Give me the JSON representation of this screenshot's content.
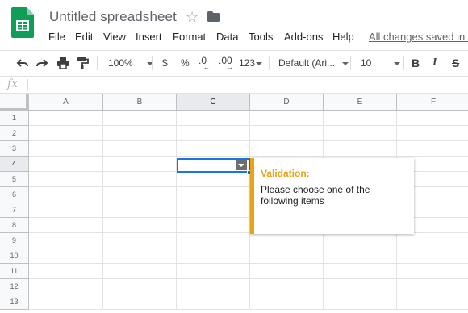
{
  "app": {
    "doc_title": "Untitled spreadsheet",
    "icons": {
      "logo": "google-sheets-logo",
      "star": "star-icon",
      "folder": "folder-icon"
    }
  },
  "menubar": {
    "items": [
      "File",
      "Edit",
      "View",
      "Insert",
      "Format",
      "Data",
      "Tools",
      "Add-ons",
      "Help"
    ],
    "save_status": "All changes saved in D"
  },
  "toolbar": {
    "zoom": "100%",
    "currency": "$",
    "percent": "%",
    "decrease_decimals": ".0",
    "increase_decimals": ".00",
    "more_formats": "123",
    "font_family": "Default (Ari...",
    "font_size": "10",
    "bold": "B",
    "italic": "I",
    "strikethrough": "S"
  },
  "formula_bar": {
    "fx_label": "fx",
    "value": ""
  },
  "grid": {
    "columns": [
      "A",
      "B",
      "C",
      "D",
      "E",
      "F"
    ],
    "rows": [
      "1",
      "2",
      "3",
      "4",
      "5",
      "6",
      "7",
      "8",
      "9",
      "10",
      "11",
      "12",
      "13"
    ],
    "selected_column": "C",
    "selected_row": "4"
  },
  "validation_popup": {
    "title": "Validation:",
    "message": "Please choose one of the following items",
    "accent_color": "#e8a317"
  },
  "colors": {
    "selection_blue": "#1a73e8",
    "sheets_green": "#0f9d58"
  }
}
